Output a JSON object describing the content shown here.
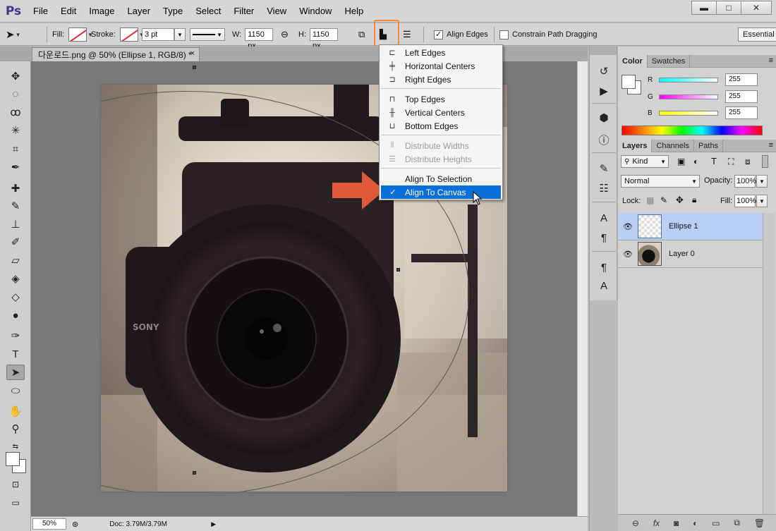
{
  "app": {
    "logo": "Ps"
  },
  "menu": [
    "File",
    "Edit",
    "Image",
    "Layer",
    "Type",
    "Select",
    "Filter",
    "View",
    "Window",
    "Help"
  ],
  "window_controls": {
    "minimize": "▬",
    "maximize": "□",
    "close": "✕"
  },
  "options": {
    "fill_label": "Fill:",
    "stroke_label": "Stroke:",
    "stroke_width": "3 pt",
    "w_label": "W:",
    "w_value": "1150 px",
    "h_label": "H:",
    "h_value": "1150 px",
    "align_edges_label": "Align Edges",
    "align_edges_checked": "✓",
    "constrain_label": "Constrain Path Dragging",
    "workspace": "Essential"
  },
  "document": {
    "tab_title": "다운로드.png @ 50% (Ellipse 1, RGB/8) *",
    "close": "×"
  },
  "status": {
    "zoom": "50%",
    "doc_size": "Doc: 3.79M/3.79M"
  },
  "align_menu": {
    "items": [
      {
        "label": "Left Edges",
        "icon": "align-left-edges-icon",
        "disabled": false
      },
      {
        "label": "Horizontal Centers",
        "icon": "align-horizontal-centers-icon",
        "disabled": false
      },
      {
        "label": "Right Edges",
        "icon": "align-right-edges-icon",
        "disabled": false
      },
      {
        "label": "Top Edges",
        "icon": "align-top-edges-icon",
        "disabled": false
      },
      {
        "label": "Vertical Centers",
        "icon": "align-vertical-centers-icon",
        "disabled": false
      },
      {
        "label": "Bottom Edges",
        "icon": "align-bottom-edges-icon",
        "disabled": false
      },
      {
        "label": "Distribute Widths",
        "icon": "distribute-widths-icon",
        "disabled": true
      },
      {
        "label": "Distribute Heights",
        "icon": "distribute-heights-icon",
        "disabled": true
      },
      {
        "label": "Align To Selection",
        "icon": "",
        "disabled": false
      },
      {
        "label": "Align To Canvas",
        "icon": "check-icon",
        "disabled": false,
        "selected": true
      }
    ]
  },
  "color_panel": {
    "tabs": [
      "Color",
      "Swatches"
    ],
    "r_label": "R",
    "g_label": "G",
    "b_label": "B",
    "r": "255",
    "g": "255",
    "b": "255"
  },
  "layers_panel": {
    "tabs": [
      "Layers",
      "Channels",
      "Paths"
    ],
    "kind": "Kind",
    "blend_mode": "Normal",
    "opacity_label": "Opacity:",
    "opacity": "100%",
    "lock_label": "Lock:",
    "fill_label": "Fill:",
    "fill": "100%",
    "layers": [
      {
        "name": "Ellipse 1",
        "selected": true
      },
      {
        "name": "Layer 0",
        "selected": false
      }
    ]
  },
  "colors": {
    "accent_blue": "#0a6fd6",
    "highlight_orange": "#ef8a3a",
    "arrow_red": "#e05a3a"
  }
}
